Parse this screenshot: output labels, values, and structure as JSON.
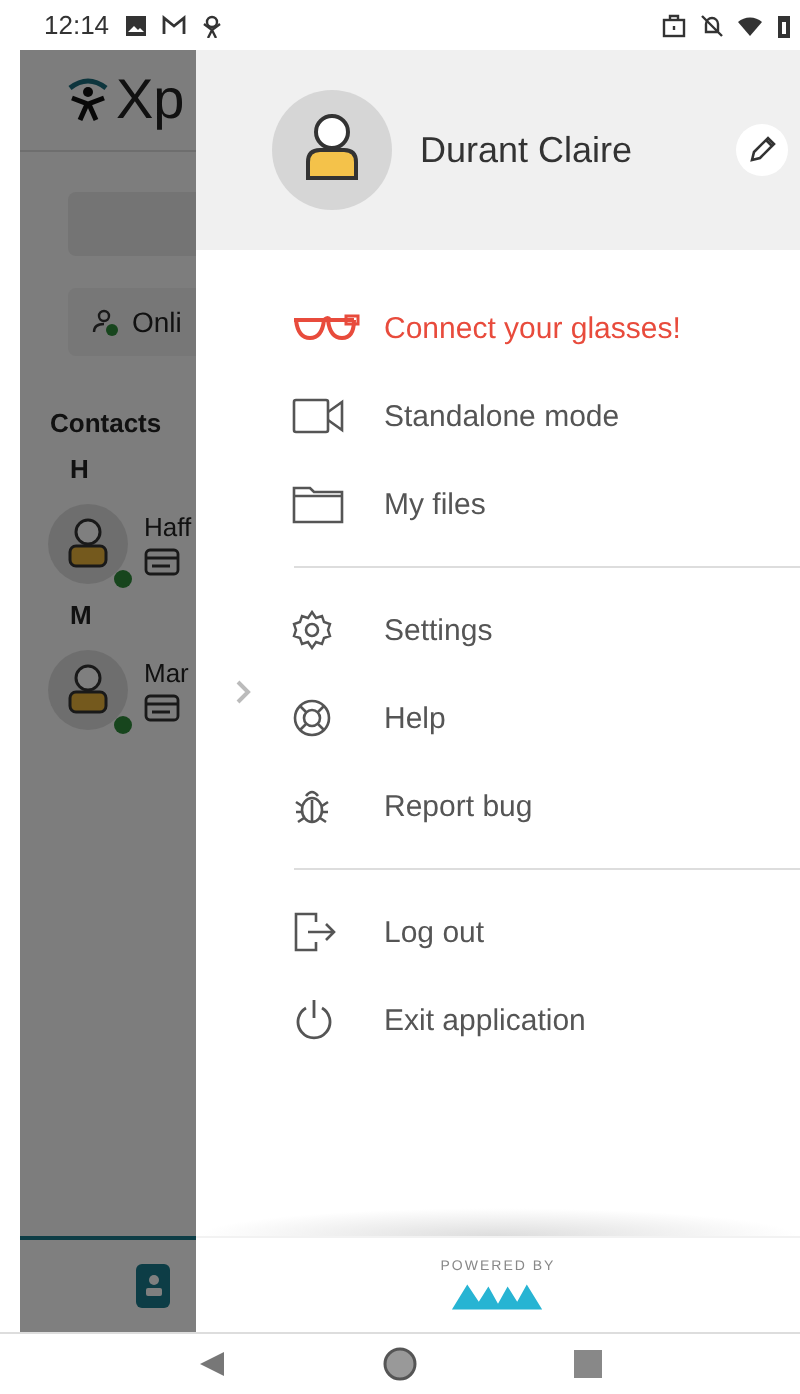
{
  "status_bar": {
    "time": "12:14"
  },
  "background": {
    "logo_text": "Xp",
    "status_chip": "Onli",
    "section_title": "Contacts",
    "groups": [
      {
        "letter": "H",
        "contacts": [
          {
            "name": "Haff"
          }
        ]
      },
      {
        "letter": "M",
        "contacts": [
          {
            "name": "Mar"
          }
        ]
      }
    ]
  },
  "drawer": {
    "user_name": "Durant Claire",
    "sections": [
      [
        {
          "label": "Connect your glasses!",
          "kind": "glasses",
          "alert": true
        },
        {
          "label": "Standalone mode",
          "kind": "video",
          "alert": false
        },
        {
          "label": "My files",
          "kind": "folder",
          "alert": false
        }
      ],
      [
        {
          "label": "Settings",
          "kind": "gear",
          "alert": false
        },
        {
          "label": "Help",
          "kind": "lifebuoy",
          "alert": false
        },
        {
          "label": "Report bug",
          "kind": "bug",
          "alert": false
        }
      ],
      [
        {
          "label": "Log out",
          "kind": "logout",
          "alert": false
        },
        {
          "label": "Exit application",
          "kind": "power",
          "alert": false
        }
      ]
    ],
    "footer": "POWERED BY"
  }
}
